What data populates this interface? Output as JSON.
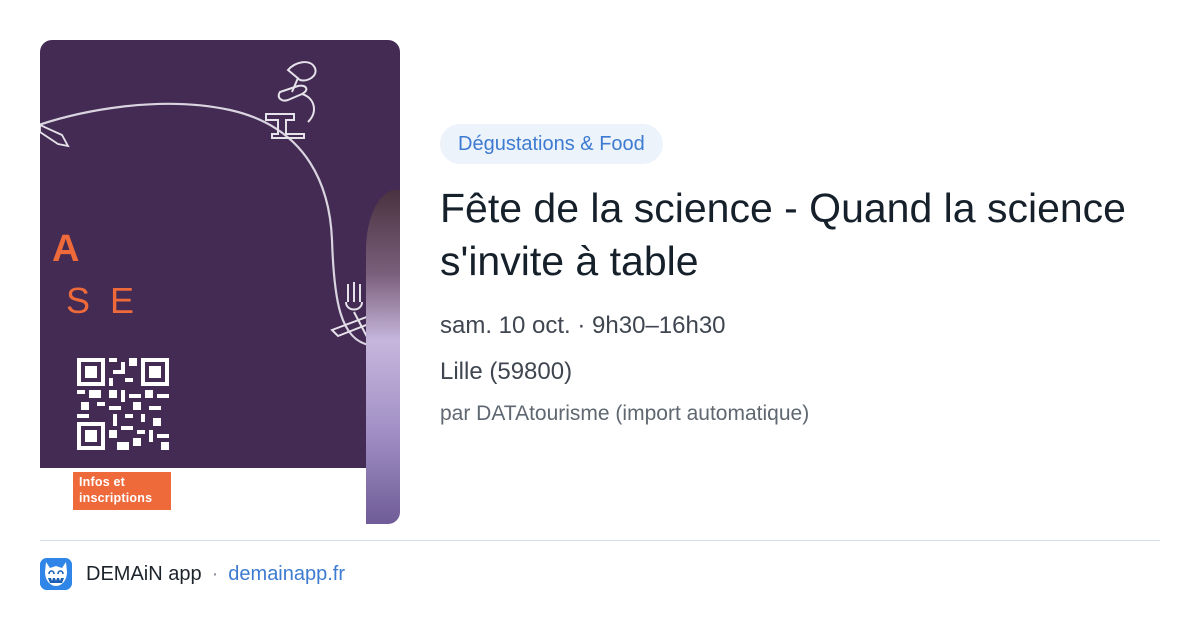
{
  "event": {
    "category": "Dégustations & Food",
    "title": "Fête de la science - Quand la science s'invite à table",
    "datetime": "sam. 10 oct. · 9h30–16h30",
    "location": "Lille (59800)",
    "source": "par DATAtourisme (import automatique)"
  },
  "poster": {
    "letter_a": "A",
    "letters_se": "SE",
    "info_label_line1": "Infos et",
    "info_label_line2": "inscriptions",
    "colors": {
      "background": "#432b53",
      "accent": "#ee6a3a"
    }
  },
  "footer": {
    "app_name": "DEMAiN app",
    "separator": "·",
    "domain": "demainapp.fr",
    "app_icon": "demain-app-icon"
  },
  "colors": {
    "category_text": "#3d7bd1",
    "category_bg": "#edf3fb",
    "title": "#15202b",
    "link": "#3d7bd1"
  }
}
